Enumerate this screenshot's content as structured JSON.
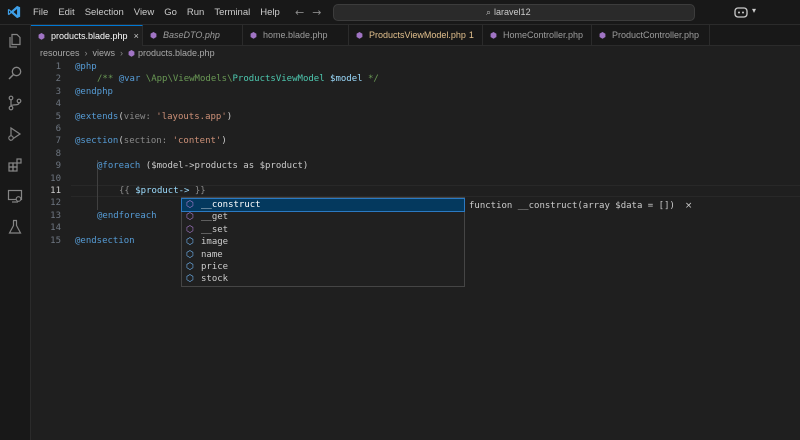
{
  "menu": [
    "File",
    "Edit",
    "Selection",
    "View",
    "Go",
    "Run",
    "Terminal",
    "Help"
  ],
  "search": {
    "text": "laravel12"
  },
  "tabs": [
    {
      "label": "products.blade.php",
      "active": true,
      "close": "×"
    },
    {
      "label": "BaseDTO.php",
      "italic": true
    },
    {
      "label": "home.blade.php"
    },
    {
      "label": "ProductsViewModel.php",
      "modified": true,
      "badge": "1"
    },
    {
      "label": "HomeController.php"
    },
    {
      "label": "ProductController.php"
    }
  ],
  "breadcrumb": [
    "resources",
    "views",
    "products.blade.php"
  ],
  "line_numbers": [
    "1",
    "2",
    "3",
    "4",
    "5",
    "6",
    "7",
    "8",
    "9",
    "10",
    "11",
    "12",
    "13",
    "14",
    "15"
  ],
  "code": {
    "l1": "@php",
    "l2_a": "/** ",
    "l2_b": "@var",
    "l2_c": " \\App\\ViewModels\\",
    "l2_d": "ProductsViewModel",
    "l2_e": " $model",
    "l2_f": " */",
    "l3": "@endphp",
    "l5_a": "@extends",
    "l5_b": "(",
    "l5_c": "view: ",
    "l5_d": "'layouts.app'",
    "l5_e": ")",
    "l7_a": "@section",
    "l7_b": "(",
    "l7_c": "section: ",
    "l7_d": "'content'",
    "l7_e": ")",
    "l9_a": "@foreach",
    "l9_b": " ($model->products as $product)",
    "l11_a": "{{ ",
    "l11_b": "$product->",
    "l11_c": " }}",
    "l13": "@endforeach",
    "l15": "@endsection"
  },
  "suggestions": [
    {
      "label": "__construct",
      "kind": "method"
    },
    {
      "label": "__get",
      "kind": "method"
    },
    {
      "label": "__set",
      "kind": "method"
    },
    {
      "label": "image",
      "kind": "property"
    },
    {
      "label": "name",
      "kind": "property"
    },
    {
      "label": "price",
      "kind": "property"
    },
    {
      "label": "stock",
      "kind": "property"
    }
  ],
  "suggestion_detail": {
    "text": "function __construct(array $data = [])",
    "close": "×"
  },
  "icons": {
    "logo": "vscode-logo-icon",
    "explorer": "files-icon",
    "search": "search-icon",
    "scm": "source-control-icon",
    "run": "run-debug-icon",
    "extensions": "extensions-icon",
    "remote": "remote-explorer-icon",
    "testing": "testing-flask-icon",
    "copilot": "copilot-icon"
  },
  "colors": {
    "accent": "#0078d4",
    "modified": "#e2c08d",
    "selection": "#04395e"
  }
}
